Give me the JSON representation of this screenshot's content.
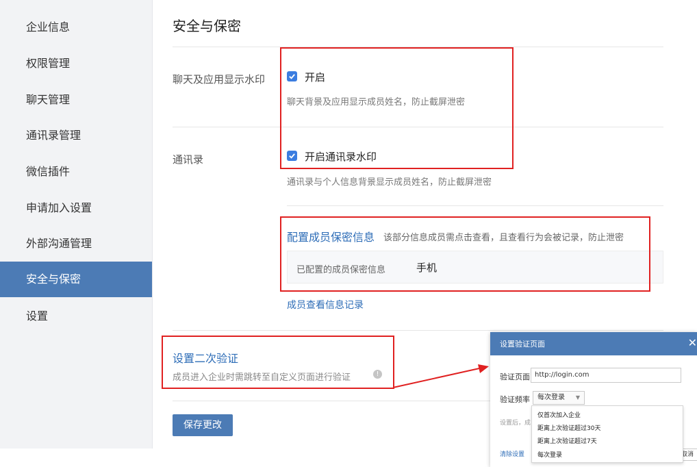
{
  "sidebar": {
    "items": [
      {
        "label": "企业信息"
      },
      {
        "label": "权限管理"
      },
      {
        "label": "聊天管理"
      },
      {
        "label": "通讯录管理"
      },
      {
        "label": "微信插件"
      },
      {
        "label": "申请加入设置"
      },
      {
        "label": "外部沟通管理"
      },
      {
        "label": "安全与保密",
        "active": true
      },
      {
        "label": "设置"
      }
    ]
  },
  "main": {
    "title": "安全与保密",
    "watermark": {
      "label": "聊天及应用显示水印",
      "option": "开启",
      "checked": true,
      "desc": "聊天背景及应用显示成员姓名，防止截屏泄密"
    },
    "contacts": {
      "label": "通讯录",
      "option": "开启通讯录水印",
      "checked": true,
      "desc": "通讯录与个人信息背景显示成员姓名，防止截屏泄密"
    },
    "confidential": {
      "title": "配置成员保密信息",
      "desc": "该部分信息成员需点击查看，且查看行为会被记录，防止泄密",
      "configured_label": "已配置的成员保密信息",
      "configured_value": "手机",
      "log_link": "成员查看信息记录"
    },
    "second_verify": {
      "title": "设置二次验证",
      "desc": "成员进入企业时需跳转至自定义页面进行验证"
    },
    "save_label": "保存更改"
  },
  "dialog": {
    "title": "设置验证页面",
    "close": "✕",
    "page_label": "验证页面",
    "page_value": "http://login.com",
    "freq_label": "验证频率",
    "freq_value": "每次登录",
    "options": [
      "仅首次加入企业",
      "距离上次验证超过30天",
      "距离上次验证超过7天",
      "每次登录"
    ],
    "note_partial": "设置后，成",
    "clear_label": "清除设置",
    "cancel_partial": "取消"
  },
  "colors": {
    "accent": "#4c7bb5",
    "checkbox": "#3b7de0",
    "highlight": "#e02020",
    "link": "#2e6db7"
  }
}
